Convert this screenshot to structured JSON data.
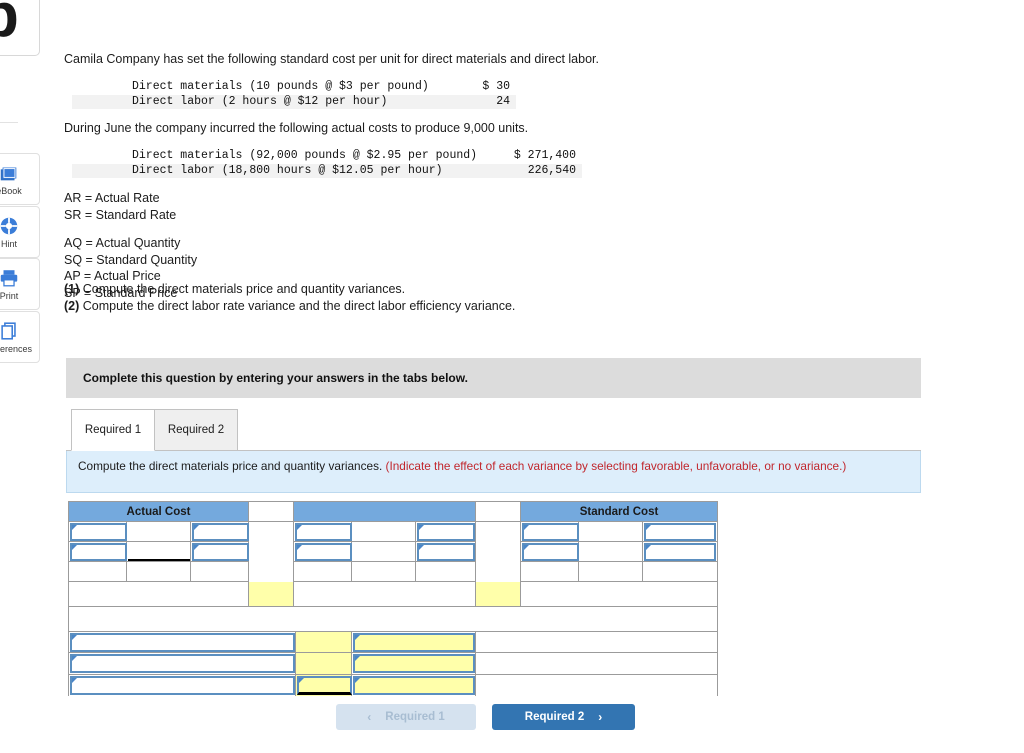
{
  "logo": {
    "glyph": "b"
  },
  "rail": {
    "items": [
      {
        "label": "eBook",
        "icon": "ebook-icon"
      },
      {
        "label": "Hint",
        "icon": "hint-icon"
      },
      {
        "label": "Print",
        "icon": "print-icon"
      },
      {
        "label": "References",
        "icon": "references-icon"
      }
    ]
  },
  "question": {
    "intro": "Camila Company has set the following standard cost per unit for direct materials and direct labor.",
    "standard_cost_table": [
      {
        "label": "Direct materials (10 pounds @ $3 per pound)",
        "amount": "$ 30"
      },
      {
        "label": "Direct labor (2 hours @ $12 per hour)",
        "amount": "24"
      }
    ],
    "during": "During June the company incurred the following actual costs to produce 9,000 units.",
    "actual_cost_table": [
      {
        "label": "Direct materials (92,000 pounds @ $2.95 per pound)",
        "amount": "$ 271,400"
      },
      {
        "label": "Direct labor (18,800 hours @ $12.05 per hour)",
        "amount": "226,540"
      }
    ],
    "definitions_group_1": [
      "AR = Actual Rate",
      "SR = Standard Rate"
    ],
    "definitions_group_2": [
      "AQ = Actual Quantity",
      "SQ = Standard Quantity",
      "AP = Actual Price",
      "SP = Standard Price"
    ],
    "requirements": [
      {
        "num": "(1)",
        "text": " Compute the direct materials price and quantity variances."
      },
      {
        "num": "(2)",
        "text": " Compute the direct labor rate variance and the direct labor efficiency variance."
      }
    ]
  },
  "banner": {
    "text": "Complete this question by entering your answers in the tabs below."
  },
  "tabs": [
    {
      "label": "Required 1",
      "active": true
    },
    {
      "label": "Required 2",
      "active": false
    }
  ],
  "prompt": {
    "black": "Compute the direct materials price and quantity variances. ",
    "red": "(Indicate the effect of each variance by selecting favorable, unfavorable, or no variance.)"
  },
  "answer_grid": {
    "headers": {
      "left": "Actual Cost",
      "middle": "",
      "right": "Standard Cost"
    },
    "rows": [
      {
        "type": "input-row",
        "cells": [
          "",
          "",
          "",
          "",
          "",
          "",
          "",
          "",
          ""
        ]
      },
      {
        "type": "input-row",
        "cells": [
          "",
          "",
          "",
          "",
          "",
          "",
          "",
          "",
          ""
        ]
      },
      {
        "type": "plain-row",
        "cells": [
          "",
          "",
          "",
          "",
          "",
          "",
          "",
          "",
          ""
        ]
      },
      {
        "type": "total-row",
        "cells": [
          "",
          "",
          "",
          "",
          "",
          "",
          "",
          "",
          ""
        ]
      },
      {
        "type": "spacer-row",
        "cells": [
          ""
        ]
      },
      {
        "type": "variance-row",
        "cells": [
          "",
          "",
          ""
        ]
      },
      {
        "type": "variance-row",
        "cells": [
          "",
          "",
          ""
        ]
      },
      {
        "type": "variance-row",
        "cells": [
          "",
          "",
          ""
        ]
      }
    ]
  },
  "nav": {
    "prev": {
      "label": "Required 1",
      "chevron": "‹",
      "enabled": false
    },
    "next": {
      "label": "Required 2",
      "chevron": "›",
      "enabled": true
    }
  },
  "colors": {
    "header_blue": "#74a9dd",
    "field_border": "#5b8fc0",
    "yellow": "#ffffaa",
    "prompt_bg": "#ddeefb",
    "red_text": "#c1272d",
    "banner_gray": "#dcdcdc",
    "button_blue": "#3375b2",
    "button_disabled": "#d5e2ef"
  }
}
